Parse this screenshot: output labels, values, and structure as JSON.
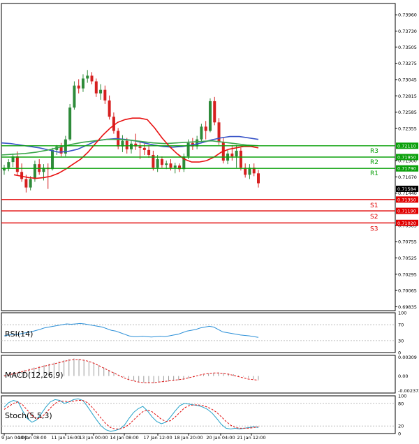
{
  "colors": {
    "bull": "#2e8b3a",
    "bear": "#d62020",
    "ma_red": "#e81010",
    "ma_blue": "#3a55c8",
    "ma_green": "#3aa64a",
    "resistance": "#0aa00a",
    "support": "#e00000",
    "rsi": "#2a8fd8",
    "macd_signal": "#e01010",
    "stoch_main": "#22a0c8",
    "stoch_signal": "#e01010"
  },
  "chart_data": {
    "type": "candlestick",
    "instrument_panel": {
      "y_ticks": [
        "0.73960",
        "0.73730",
        "0.73505",
        "0.73275",
        "0.73045",
        "0.72815",
        "0.72585",
        "0.72355",
        "0.71900",
        "0.71670",
        "0.71440",
        "0.70985",
        "0.70755",
        "0.70525",
        "0.70295",
        "0.70065",
        "0.69835"
      ],
      "ylim": [
        0.6978,
        0.7412
      ],
      "x_ticks": [
        "9 Jan 04:00",
        "10 Jan 08:00",
        "11 Jan 16:00",
        "13 Jan 00:00",
        "14 Jan 08:00",
        "17 Jan 12:00",
        "18 Jan 20:00",
        "20 Jan 04:00",
        "21 Jan 12:00"
      ],
      "current_price": "0.71584",
      "levels": [
        {
          "name": "R3",
          "value": 0.7211,
          "label": "0.72110",
          "kind": "resistance"
        },
        {
          "name": "R2",
          "value": 0.7195,
          "label": "0.71950",
          "kind": "resistance"
        },
        {
          "name": "R1",
          "value": 0.7179,
          "label": "0.71790",
          "kind": "resistance"
        },
        {
          "name": "S1",
          "value": 0.7135,
          "label": "0.71350",
          "kind": "support"
        },
        {
          "name": "S2",
          "value": 0.7119,
          "label": "0.71190",
          "kind": "support"
        },
        {
          "name": "S3",
          "value": 0.7102,
          "label": "0.71020",
          "kind": "support"
        }
      ],
      "candles": [
        [
          0.7176,
          0.7184,
          0.717,
          0.718
        ],
        [
          0.718,
          0.7192,
          0.7175,
          0.7188
        ],
        [
          0.7188,
          0.72,
          0.7181,
          0.7196
        ],
        [
          0.7196,
          0.7203,
          0.717,
          0.7174
        ],
        [
          0.7174,
          0.7186,
          0.716,
          0.7164
        ],
        [
          0.7164,
          0.717,
          0.7145,
          0.7152
        ],
        [
          0.7152,
          0.7168,
          0.7148,
          0.7164
        ],
        [
          0.7164,
          0.719,
          0.716,
          0.7185
        ],
        [
          0.7185,
          0.7192,
          0.717,
          0.7174
        ],
        [
          0.7174,
          0.7185,
          0.7162,
          0.718
        ],
        [
          0.718,
          0.7186,
          0.715,
          0.7178
        ],
        [
          0.7178,
          0.7208,
          0.7176,
          0.7205
        ],
        [
          0.7205,
          0.7212,
          0.7198,
          0.721
        ],
        [
          0.721,
          0.7215,
          0.7196,
          0.72
        ],
        [
          0.72,
          0.7225,
          0.7196,
          0.722
        ],
        [
          0.722,
          0.727,
          0.7218,
          0.7265
        ],
        [
          0.7265,
          0.7302,
          0.7262,
          0.7296
        ],
        [
          0.7296,
          0.7305,
          0.7285,
          0.7292
        ],
        [
          0.7292,
          0.7312,
          0.7287,
          0.7306
        ],
        [
          0.7306,
          0.7318,
          0.73,
          0.731
        ],
        [
          0.731,
          0.7315,
          0.7298,
          0.7302
        ],
        [
          0.7302,
          0.7306,
          0.728,
          0.7285
        ],
        [
          0.7285,
          0.7298,
          0.7276,
          0.729
        ],
        [
          0.729,
          0.7296,
          0.727,
          0.7275
        ],
        [
          0.7275,
          0.7282,
          0.7248,
          0.7252
        ],
        [
          0.7252,
          0.7258,
          0.7228,
          0.7232
        ],
        [
          0.7232,
          0.7236,
          0.7206,
          0.721
        ],
        [
          0.721,
          0.7226,
          0.7202,
          0.7218
        ],
        [
          0.7218,
          0.7222,
          0.72,
          0.7206
        ],
        [
          0.7206,
          0.7218,
          0.72,
          0.7214
        ],
        [
          0.7214,
          0.7228,
          0.7205,
          0.721
        ],
        [
          0.721,
          0.7216,
          0.7192,
          0.7208
        ],
        [
          0.7208,
          0.7214,
          0.7198,
          0.7205
        ],
        [
          0.7205,
          0.7212,
          0.7194,
          0.7198
        ],
        [
          0.7198,
          0.7204,
          0.7176,
          0.718
        ],
        [
          0.718,
          0.7198,
          0.7174,
          0.7192
        ],
        [
          0.7192,
          0.7196,
          0.718,
          0.7184
        ],
        [
          0.7184,
          0.719,
          0.7178,
          0.7186
        ],
        [
          0.7186,
          0.7192,
          0.7176,
          0.718
        ],
        [
          0.718,
          0.7187,
          0.7172,
          0.7183
        ],
        [
          0.7183,
          0.7186,
          0.7174,
          0.7178
        ],
        [
          0.7178,
          0.72,
          0.7174,
          0.7196
        ],
        [
          0.7196,
          0.722,
          0.7192,
          0.7215
        ],
        [
          0.7215,
          0.7222,
          0.7205,
          0.721
        ],
        [
          0.721,
          0.7225,
          0.7206,
          0.722
        ],
        [
          0.722,
          0.7242,
          0.7216,
          0.7238
        ],
        [
          0.7238,
          0.7246,
          0.722,
          0.7232
        ],
        [
          0.7232,
          0.7278,
          0.723,
          0.7274
        ],
        [
          0.7274,
          0.728,
          0.724,
          0.7244
        ],
        [
          0.7244,
          0.725,
          0.7212,
          0.7216
        ],
        [
          0.7216,
          0.7222,
          0.7186,
          0.719
        ],
        [
          0.719,
          0.7206,
          0.7185,
          0.72
        ],
        [
          0.72,
          0.7212,
          0.719,
          0.7196
        ],
        [
          0.7196,
          0.7212,
          0.718,
          0.7204
        ],
        [
          0.7204,
          0.7208,
          0.7176,
          0.718
        ],
        [
          0.718,
          0.7186,
          0.7166,
          0.717
        ],
        [
          0.717,
          0.7185,
          0.7164,
          0.718
        ],
        [
          0.718,
          0.7186,
          0.7168,
          0.7172
        ],
        [
          0.7172,
          0.7177,
          0.7152,
          0.7158
        ]
      ],
      "ma_red": [
        0.717,
        0.7168,
        0.7166,
        0.7165,
        0.7166,
        0.7168,
        0.7172,
        0.7178,
        0.7185,
        0.7192,
        0.7202,
        0.7214,
        0.7226,
        0.7236,
        0.7244,
        0.7248,
        0.725,
        0.725,
        0.7248,
        0.7236,
        0.7222,
        0.721,
        0.72,
        0.7192,
        0.7188,
        0.7188,
        0.719,
        0.7195,
        0.7202,
        0.7206,
        0.7208,
        0.721,
        0.721,
        0.7208
      ],
      "ma_blue": [
        0.7215,
        0.7214,
        0.7212,
        0.721,
        0.7208,
        0.7205,
        0.7202,
        0.7203,
        0.7206,
        0.7212,
        0.7218,
        0.722,
        0.7221,
        0.722,
        0.7218,
        0.7215,
        0.7212,
        0.721,
        0.7209,
        0.721,
        0.7212,
        0.7215,
        0.7219,
        0.7222,
        0.7224,
        0.7224,
        0.7222,
        0.722
      ],
      "ma_green": [
        0.7198,
        0.7199,
        0.72,
        0.7202,
        0.7205,
        0.7209,
        0.7213,
        0.7216,
        0.7218,
        0.722,
        0.722,
        0.7219,
        0.7217,
        0.7215,
        0.7214,
        0.7215,
        0.7216,
        0.7217,
        0.7218,
        0.7216,
        0.7214,
        0.7212,
        0.7211
      ]
    },
    "rsi_panel": {
      "label": "RSI(14)",
      "y_ticks": [
        "100",
        "70",
        "30",
        "0"
      ],
      "ylim": [
        0,
        100
      ],
      "values": [
        42,
        44,
        46,
        45,
        48,
        50,
        52,
        55,
        58,
        62,
        64,
        66,
        68,
        70,
        72,
        71,
        72,
        73,
        72,
        70,
        68,
        66,
        64,
        60,
        56,
        54,
        50,
        46,
        42,
        40,
        40,
        41,
        40,
        39,
        40,
        41,
        40,
        42,
        44,
        46,
        50,
        54,
        56,
        58,
        62,
        64,
        66,
        64,
        58,
        52,
        50,
        48,
        46,
        44,
        43,
        42,
        40,
        38
      ]
    },
    "macd_panel": {
      "label": "MACD(12,26,9)",
      "y_ticks": [
        "0.00309",
        "0.00",
        "-0.002372"
      ],
      "ylim": [
        -0.0028,
        0.0034
      ],
      "histogram": [
        0.0002,
        0.0004,
        0.0006,
        0.0008,
        0.001,
        0.0012,
        0.0014,
        0.0016,
        0.0018,
        0.002,
        0.0022,
        0.0024,
        0.0026,
        0.0028,
        0.0029,
        0.0028,
        0.0026,
        0.0024,
        0.0022,
        0.0018,
        0.0014,
        0.001,
        0.0006,
        0.0002,
        -0.0002,
        -0.0006,
        -0.0008,
        -0.001,
        -0.0011,
        -0.0012,
        -0.0012,
        -0.0011,
        -0.001,
        -0.0009,
        -0.0008,
        -0.0007,
        -0.0006,
        -0.0004,
        -0.0002,
        0.0,
        0.0002,
        0.0004,
        0.0005,
        0.0006,
        0.0005,
        0.0004,
        0.0003,
        0.0001,
        -0.0001,
        -0.0003,
        -0.0005,
        -0.0006
      ],
      "signal": [
        0.0,
        0.0002,
        0.0004,
        0.0006,
        0.0008,
        0.001,
        0.0012,
        0.0014,
        0.0016,
        0.0018,
        0.002,
        0.0022,
        0.0024,
        0.0026,
        0.0027,
        0.0027,
        0.0026,
        0.0024,
        0.0021,
        0.0017,
        0.0013,
        0.0009,
        0.0005,
        0.0001,
        -0.0003,
        -0.0006,
        -0.0008,
        -0.001,
        -0.0011,
        -0.0011,
        -0.0011,
        -0.001,
        -0.0009,
        -0.0008,
        -0.0007,
        -0.0006,
        -0.0005,
        -0.0003,
        -0.0001,
        0.0001,
        0.0003,
        0.0004,
        0.0005,
        0.0005,
        0.0004,
        0.0003,
        0.0001,
        -0.0001,
        -0.0003,
        -0.0005,
        -0.0006,
        -0.0007
      ]
    },
    "stoch_panel": {
      "label": "Stoch(5,5,3)",
      "y_ticks": [
        "100",
        "80",
        "20",
        "0"
      ],
      "ylim": [
        0,
        100
      ],
      "main": [
        70,
        82,
        88,
        84,
        60,
        40,
        30,
        36,
        52,
        70,
        84,
        90,
        88,
        80,
        84,
        90,
        92,
        88,
        72,
        54,
        36,
        20,
        10,
        6,
        8,
        12,
        22,
        40,
        56,
        66,
        72,
        60,
        44,
        32,
        26,
        30,
        44,
        60,
        74,
        80,
        78,
        76,
        74,
        70,
        64,
        54,
        40,
        24,
        14,
        12,
        14,
        12,
        14,
        16,
        18,
        16
      ],
      "signal": [
        64,
        72,
        80,
        84,
        76,
        62,
        48,
        38,
        42,
        54,
        68,
        80,
        86,
        86,
        84,
        86,
        88,
        88,
        82,
        70,
        56,
        40,
        26,
        16,
        12,
        12,
        16,
        24,
        36,
        48,
        58,
        62,
        58,
        48,
        38,
        32,
        34,
        44,
        56,
        68,
        74,
        76,
        76,
        74,
        70,
        64,
        56,
        44,
        32,
        22,
        16,
        14,
        14,
        14,
        16,
        18
      ]
    }
  }
}
